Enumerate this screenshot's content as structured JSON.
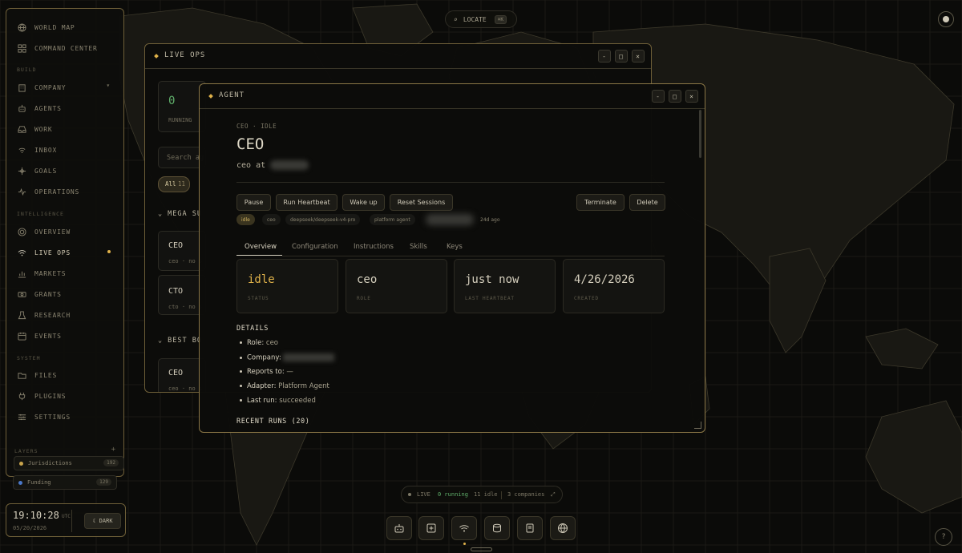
{
  "sidebar": {
    "top_items": [
      {
        "label": "WORLD MAP",
        "icon": "globe-icon"
      },
      {
        "label": "COMMAND CENTER",
        "icon": "grid-icon"
      }
    ],
    "sections": {
      "build": "BUILD",
      "intelligence": "INTELLIGENCE",
      "system": "SYSTEM"
    },
    "build_items": [
      {
        "label": "COMPANY",
        "icon": "building-icon"
      },
      {
        "label": "AGENTS",
        "icon": "robot-icon"
      },
      {
        "label": "WORK",
        "icon": "tray-icon"
      },
      {
        "label": "INBOX",
        "icon": "signal-icon"
      },
      {
        "label": "GOALS",
        "icon": "crosshair-icon"
      },
      {
        "label": "OPERATIONS",
        "icon": "pulse-icon"
      }
    ],
    "intel_items": [
      {
        "label": "OVERVIEW",
        "icon": "target-icon"
      },
      {
        "label": "LIVE OPS",
        "icon": "wifi-icon"
      },
      {
        "label": "MARKETS",
        "icon": "chart-icon"
      },
      {
        "label": "GRANTS",
        "icon": "cash-icon"
      },
      {
        "label": "RESEARCH",
        "icon": "beaker-icon"
      },
      {
        "label": "EVENTS",
        "icon": "calendar-icon"
      }
    ],
    "system_items": [
      {
        "label": "FILES",
        "icon": "folder-icon"
      },
      {
        "label": "PLUGINS",
        "icon": "plug-icon"
      },
      {
        "label": "SETTINGS",
        "icon": "sliders-icon"
      }
    ],
    "layers_title": "LAYERS",
    "layers": [
      {
        "label": "Jurisdictions",
        "count": "192",
        "color": "#c9a44c"
      },
      {
        "label": "Funding",
        "count": "129",
        "color": "#4a78c9"
      }
    ]
  },
  "clock": {
    "time": "19:10:28",
    "tz": "UTC",
    "date": "05/20/2026",
    "theme_label": "DARK"
  },
  "locate": {
    "label": "LOCATE",
    "shortcut": "⌘K"
  },
  "live_ops": {
    "title": "LIVE OPS",
    "running_count": "0",
    "running_label": "RUNNING",
    "search_placeholder": "Search ag",
    "filter_all": "All",
    "filter_count": "11",
    "group1": "MEGA SU",
    "group2": "BEST BO",
    "cards": [
      {
        "name": "CEO",
        "sub": "ceo · no s"
      },
      {
        "name": "CTO",
        "sub": "cto · no s"
      },
      {
        "name": "CEO",
        "sub": "ceo · no s"
      }
    ]
  },
  "agent": {
    "window_title": "AGENT",
    "subtitle": "CEO · IDLE",
    "name": "CEO",
    "line": "ceo at",
    "actions": [
      "Pause",
      "Run Heartbeat",
      "Wake up",
      "Reset Sessions"
    ],
    "danger_actions": [
      "Terminate",
      "Delete"
    ],
    "tags": [
      "idle",
      "ceo",
      "deepseek/deepseek-v4-pro",
      "platform agent",
      "24d ago"
    ],
    "tabs": [
      "Overview",
      "Configuration",
      "Instructions",
      "Skills",
      "Keys"
    ],
    "stats": [
      {
        "value": "idle",
        "label": "STATUS"
      },
      {
        "value": "ceo",
        "label": "ROLE"
      },
      {
        "value": "just now",
        "label": "LAST HEARTBEAT"
      },
      {
        "value": "4/26/2026",
        "label": "CREATED"
      }
    ],
    "details_title": "DETAILS",
    "details": [
      {
        "k": "Role:",
        "v": "ceo"
      },
      {
        "k": "Company:",
        "v": ""
      },
      {
        "k": "Reports to:",
        "v": "—"
      },
      {
        "k": "Adapter:",
        "v": "Platform Agent"
      },
      {
        "k": "Last run:",
        "v": "succeeded"
      }
    ],
    "recent_runs": "RECENT RUNS (20)"
  },
  "statusbar": {
    "live": "LIVE",
    "running": "0 running",
    "idle": "11 idle",
    "companies": "3 companies"
  },
  "colors": {
    "accent": "#e0b24a",
    "border": "#6e5f38",
    "running": "#5fae6a"
  }
}
